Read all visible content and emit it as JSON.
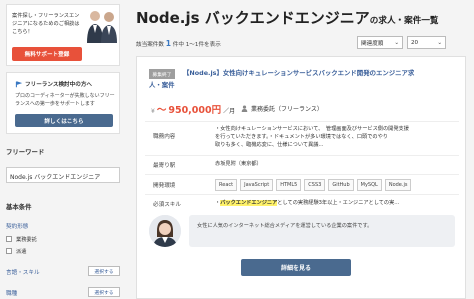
{
  "sidebar": {
    "banner_text": "案件探し・フリーランスエンジニアになるためのご相談はこちら！",
    "banner_button": "無料サポート登録",
    "beginner_title": "フリーランス検討中の方へ",
    "beginner_desc": "プロのコーディネーターが失敗しないフリーランスへの第一歩をサポートします",
    "beginner_button": "詳しくはこちら",
    "freeword_title": "フリーワード",
    "freeword_value": "Node.js バックエンドエンジニア",
    "basic_title": "基本条件",
    "contract_title": "契約形態",
    "contract_options": [
      "業務委託",
      "派遣"
    ],
    "lang_title": "言語・スキル",
    "type_title": "職種",
    "select_label": "選択する"
  },
  "main": {
    "title": "Node.js バックエンドエンジニア",
    "title_suffix": "の求人・案件一覧",
    "count_prefix": "該当案件数",
    "count": "1",
    "count_suffix": "件中 1〜1件を表示",
    "sort": "関連度順",
    "per_page": "20"
  },
  "job": {
    "status": "募集終了",
    "title": "【Node.js】女性向けキュレーションサービスバックエンド開発のエンジニア求",
    "title2": "人・案件",
    "money_prefix": "〜",
    "money": "950,000円",
    "money_unit": "／月",
    "contract": "業務委託（フリーランス）",
    "desc_label": "職務内容",
    "desc_lines": [
      "・女性向けキュレーションサービスにおいて、　管理画面及びサービス側の開発支援",
      "を行っていただきます。・ドキュメントが多い環境ではなく、口頭でのやり",
      "取りも多く、臨機応変に、仕様について異議..."
    ],
    "station_label": "最寄り駅",
    "station": "赤坂見附（東京都）",
    "env_label": "開発環境",
    "skills": [
      "React",
      "JavaScript",
      "HTML5",
      "CSS3",
      "GitHub",
      "MySQL",
      "Node.js"
    ],
    "req_label": "必須スキル",
    "req_prefix": "・",
    "req_hl": "バックエンドエンジニア",
    "req_rest": "としての実務経験3年以上・エンジニアとしての実...",
    "comment": "女性に人気のインターネット総合メディアを運営している企業の案件です。",
    "detail_button": "詳細を見る"
  },
  "colors": {
    "accent": "#e8513a",
    "link": "#3a5f9a",
    "button": "#4a6a8f",
    "highlight": "#fff26a"
  }
}
